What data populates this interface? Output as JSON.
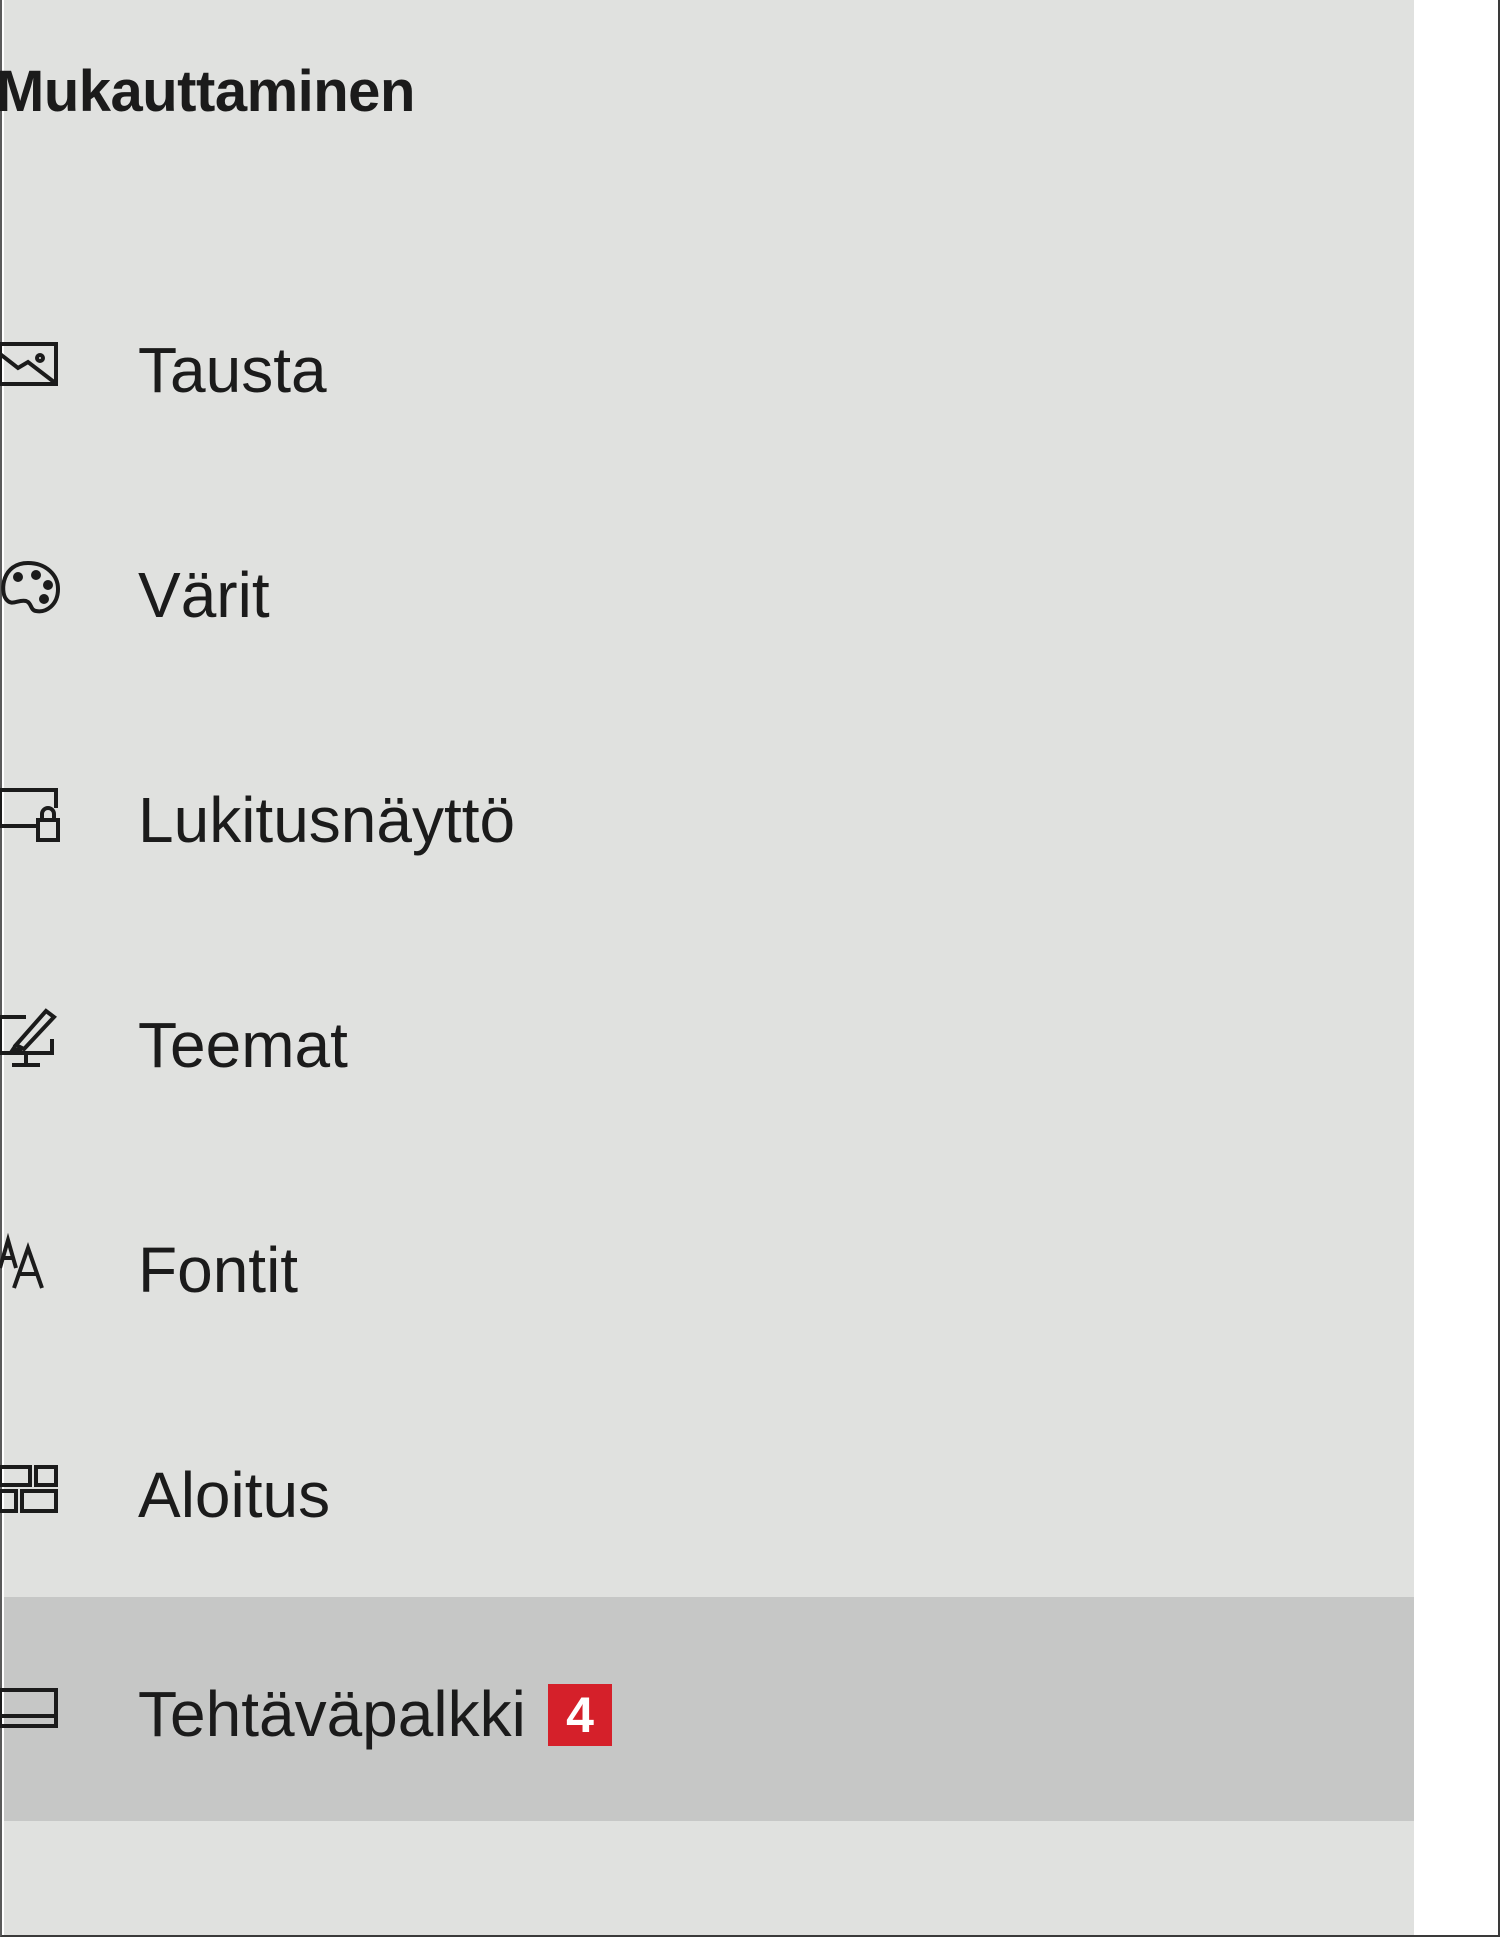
{
  "sidebar": {
    "title": "Mukauttaminen",
    "items": [
      {
        "label": "Tausta",
        "icon": "background-picture-icon"
      },
      {
        "label": "Värit",
        "icon": "palette-icon"
      },
      {
        "label": "Lukitusnäyttö",
        "icon": "lock-screen-icon"
      },
      {
        "label": "Teemat",
        "icon": "themes-brush-icon"
      },
      {
        "label": "Fontit",
        "icon": "fonts-icon"
      },
      {
        "label": "Aloitus",
        "icon": "start-tiles-icon"
      },
      {
        "label": "Tehtäväpalkki",
        "icon": "taskbar-icon",
        "selected": true,
        "badge": "4"
      }
    ]
  },
  "colors": {
    "sidebar_bg": "#e0e1df",
    "selected_bg": "#c6c7c6",
    "badge_bg": "#d5202a",
    "text": "#1b1b1b"
  }
}
